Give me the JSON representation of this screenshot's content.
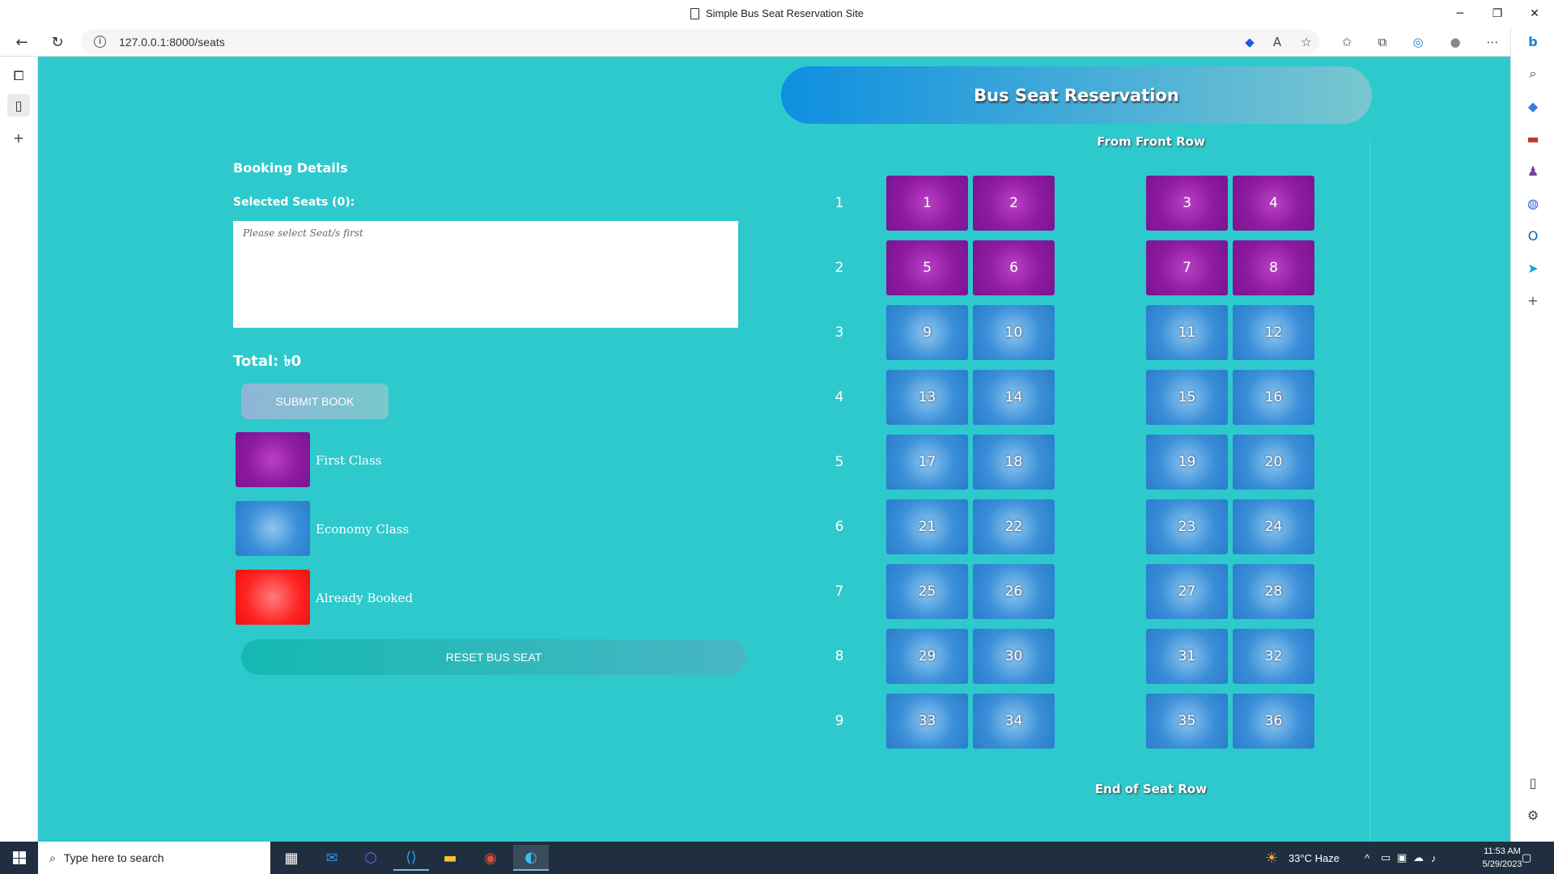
{
  "window": {
    "title": "Simple Bus Seat Reservation Site"
  },
  "browser": {
    "url": "127.0.0.1:8000/seats"
  },
  "booking": {
    "title": "Booking Details",
    "selected_label": "Selected Seats (0):",
    "placeholder": "Please select Seat/s first",
    "total": "Total: ৳0",
    "submit_label": "SUBMIT BOOK",
    "reset_label": "RESET BUS SEAT",
    "legend": [
      {
        "label": "First Class",
        "color": "#8e1aa0"
      },
      {
        "label": "Economy Class",
        "color": "#3a8fd8"
      },
      {
        "label": "Already Booked",
        "color": "#f22"
      }
    ]
  },
  "reservation": {
    "banner": "Bus Seat Reservation",
    "front_label": "From Front Row",
    "end_label": "End of Seat Row",
    "rows": [
      {
        "row": "1",
        "seats": [
          "1",
          "2",
          "3",
          "4"
        ],
        "class": "first"
      },
      {
        "row": "2",
        "seats": [
          "5",
          "6",
          "7",
          "8"
        ],
        "class": "first"
      },
      {
        "row": "3",
        "seats": [
          "9",
          "10",
          "11",
          "12"
        ],
        "class": "economy"
      },
      {
        "row": "4",
        "seats": [
          "13",
          "14",
          "15",
          "16"
        ],
        "class": "economy"
      },
      {
        "row": "5",
        "seats": [
          "17",
          "18",
          "19",
          "20"
        ],
        "class": "economy"
      },
      {
        "row": "6",
        "seats": [
          "21",
          "22",
          "23",
          "24"
        ],
        "class": "economy"
      },
      {
        "row": "7",
        "seats": [
          "25",
          "26",
          "27",
          "28"
        ],
        "class": "economy"
      },
      {
        "row": "8",
        "seats": [
          "29",
          "30",
          "31",
          "32"
        ],
        "class": "economy"
      },
      {
        "row": "9",
        "seats": [
          "33",
          "34",
          "35",
          "36"
        ],
        "class": "economy"
      }
    ]
  },
  "taskbar": {
    "search_placeholder": "Type here to search",
    "weather": "33°C  Haze",
    "time": "11:53 AM",
    "date": "5/29/2023"
  }
}
